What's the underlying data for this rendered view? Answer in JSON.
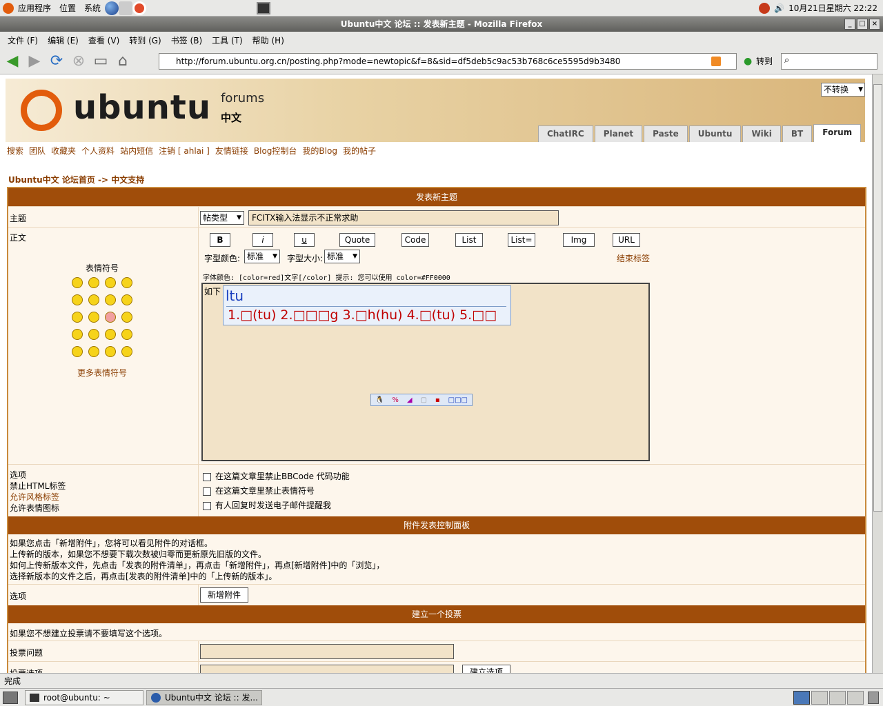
{
  "system": {
    "menus": [
      "应用程序",
      "位置",
      "系统"
    ],
    "clock": "10月21日星期六 22:22"
  },
  "window": {
    "title": "Ubuntu中文 论坛 :: 发表新主题 - Mozilla Firefox"
  },
  "menubar": [
    "文件 (F)",
    "编辑 (E)",
    "查看 (V)",
    "转到 (G)",
    "书签 (B)",
    "工具 (T)",
    "帮助 (H)"
  ],
  "navigation": {
    "url": "http://forum.ubuntu.org.cn/posting.php?mode=newtopic&f=8&sid=df5deb5c9ac53b768c6ce5595d9b3480",
    "go_label": "转到"
  },
  "site": {
    "logo_text": "ubuntu",
    "forums_label": "forums",
    "zh_label": "中文",
    "convert_select": "不转换",
    "tabs": [
      "ChatIRC",
      "Planet",
      "Paste",
      "Ubuntu",
      "Wiki",
      "BT",
      "Forum"
    ],
    "links": [
      "搜索",
      "团队",
      "收藏夹",
      "个人资料",
      "站内短信",
      "注销 [ ahlai ]",
      "友情链接",
      "Blog控制台",
      "我的Blog",
      "我的帖子"
    ],
    "breadcrumb": "Ubuntu中文 论坛首页  ->  中文支持"
  },
  "post_form": {
    "header": "发表新主题",
    "subject_label": "主题",
    "post_type": "帖类型",
    "subject_value": "FCITX输入法显示不正常求助",
    "body_label": "正文",
    "emoticons_label": "表情符号",
    "more_emoticons": "更多表情符号",
    "bbcode_buttons": [
      "B",
      "i",
      "u",
      "Quote",
      "Code",
      "List",
      "List=",
      "Img",
      "URL"
    ],
    "color_label": "字型颜色:",
    "color_value": "标准",
    "size_label": "字型大小:",
    "size_value": "标准",
    "close_tags": "结束标签",
    "hint": "字体颜色: [color=red]文字[/color]  提示: 您可以使用 color=#FF0000",
    "textarea_value": "如下",
    "ime_input": "ltu",
    "ime_candidates": "1.□(tu) 2.□□□g 3.□h(hu) 4.□(tu) 5.□□",
    "options_label": "选项",
    "html_status": "禁止HTML标签",
    "bbcode_status": "允许风格标签",
    "smilies_status": "允许表情图标",
    "options": [
      "在这篇文章里禁止BBCode 代码功能",
      "在这篇文章里禁止表情符号",
      "有人回复时发送电子邮件提醒我"
    ]
  },
  "attachments": {
    "header": "附件发表控制面板",
    "text": [
      "如果您点击「新增附件」，您将可以看见附件的对话框。",
      "上传新的版本，如果您不想要下载次数被归零而更新原先旧版的文件。",
      "如何上传新版本文件，先点击「发表的附件清单」，再点击「新增附件」，再点[新增附件]中的「浏览」，",
      "选择新版本的文件之后，再点击[发表的附件清单]中的「上传新的版本」。"
    ],
    "options_label": "选项",
    "add_button": "新增附件"
  },
  "poll": {
    "header": "建立一个投票",
    "note": "如果您不想建立投票请不要填写这个选项。",
    "question_label": "投票问题",
    "option_label": "投票选项",
    "add_option_button": "建立选项"
  },
  "statusbar": "完成",
  "taskbar": [
    "root@ubuntu: ~",
    "Ubuntu中文 论坛 :: 发..."
  ]
}
